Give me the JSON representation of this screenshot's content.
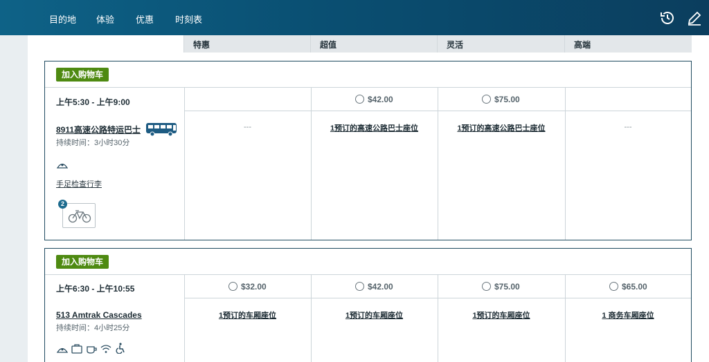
{
  "nav": {
    "items": [
      "目的地",
      "体验",
      "优惠",
      "时刻表"
    ],
    "icons": [
      "history-icon",
      "edit-icon"
    ]
  },
  "fare_columns": [
    "特惠",
    "超值",
    "灵活",
    "高端"
  ],
  "colors": {
    "nav": "#0b4f72",
    "cart_button": "#4e8a11",
    "card_border": "#1e4a5f"
  },
  "trips": [
    {
      "cart_label": "加入购物车",
      "time": "上午5:30 - 上午9:00",
      "route": "8911高速公路特运巴士",
      "duration": "持续时间：3小时30分",
      "bag_link": "手足检查行李",
      "bike_count": "2",
      "prices": [
        "",
        "$42.00",
        "$75.00",
        ""
      ],
      "seats": [
        "---",
        "1预订的高速公路巴士座位",
        "1预订的高速公路巴士座位",
        "---"
      ]
    },
    {
      "cart_label": "加入购物车",
      "time": "上午6:30 - 上午10:55",
      "route": "513 Amtrak Cascades",
      "duration": "持续时间：4小时25分",
      "prices": [
        "$32.00",
        "$42.00",
        "$75.00",
        "$65.00"
      ],
      "seats": [
        "1预订的车厢座位",
        "1预订的车厢座位",
        "1预订的车厢座位",
        "1 商务车厢座位"
      ]
    }
  ]
}
